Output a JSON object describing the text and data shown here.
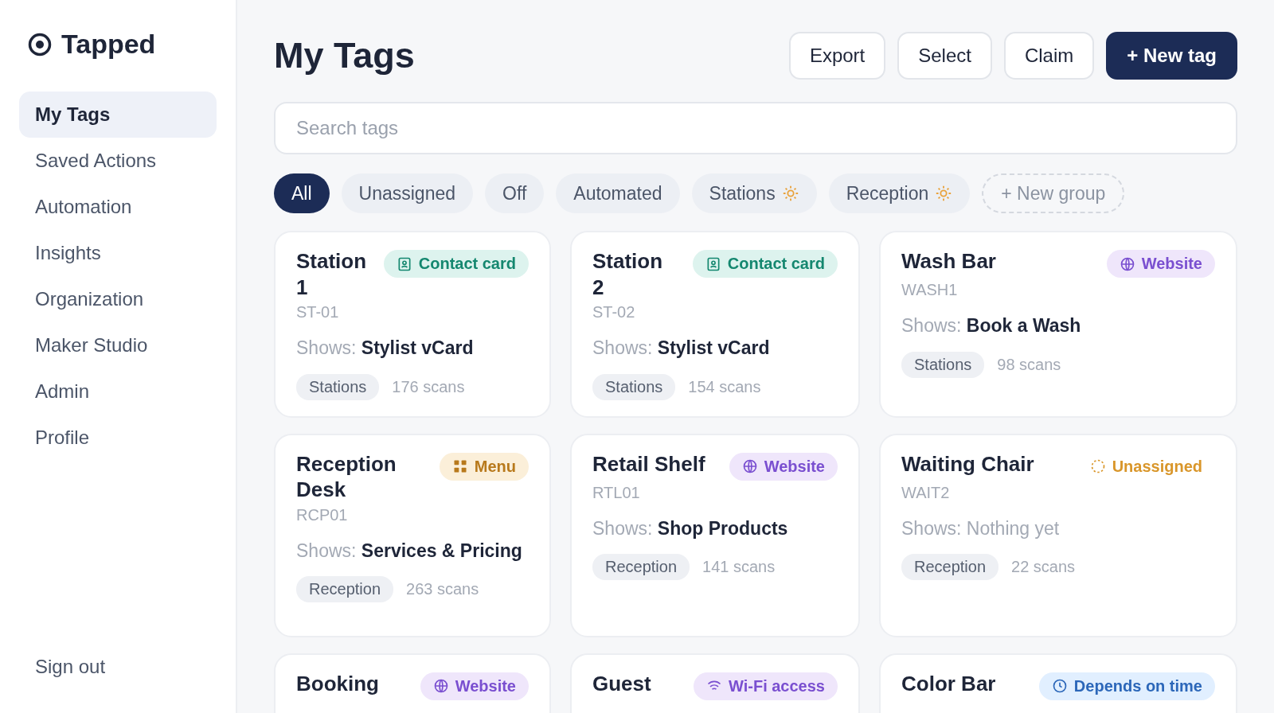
{
  "brand": {
    "name": "Tapped"
  },
  "sidebar": {
    "items": [
      {
        "label": "My Tags",
        "selected": true
      },
      {
        "label": "Saved Actions",
        "selected": false
      },
      {
        "label": "Automation",
        "selected": false
      },
      {
        "label": "Insights",
        "selected": false
      },
      {
        "label": "Organization",
        "selected": false
      },
      {
        "label": "Maker Studio",
        "selected": false
      },
      {
        "label": "Admin",
        "selected": false
      },
      {
        "label": "Profile",
        "selected": false
      }
    ],
    "footer": "Sign out"
  },
  "header": {
    "title": "My Tags",
    "buttons": [
      {
        "label": "Export",
        "kind": "outline"
      },
      {
        "label": "Select",
        "kind": "outline"
      },
      {
        "label": "Claim",
        "kind": "outline"
      },
      {
        "label": "+ New tag",
        "kind": "primary"
      }
    ]
  },
  "search": {
    "placeholder": "Search tags"
  },
  "filters": [
    {
      "label": "All",
      "selected": true,
      "automated": false
    },
    {
      "label": "Unassigned",
      "selected": false,
      "automated": false
    },
    {
      "label": "Off",
      "selected": false,
      "automated": false
    },
    {
      "label": "Automated",
      "selected": false,
      "automated": false
    },
    {
      "label": "Stations",
      "selected": false,
      "automated": true
    },
    {
      "label": "Reception",
      "selected": false,
      "automated": true
    }
  ],
  "new_group": "+ New group",
  "tags": [
    {
      "title": "Station 1",
      "badge": {
        "kind": "contact",
        "label": "Contact card"
      },
      "code": "ST-01",
      "shows": "Shows: **Stylist vCard**",
      "group": "Stations",
      "scans": "176 scans"
    },
    {
      "title": "Station 2",
      "badge": {
        "kind": "contact",
        "label": "Contact card"
      },
      "code": "ST-02",
      "shows": "Shows: **Stylist vCard**",
      "group": "Stations",
      "scans": "154 scans"
    },
    {
      "title": "Wash Bar",
      "badge": {
        "kind": "website",
        "label": "Website"
      },
      "code": "WASH1",
      "shows": "Shows: **Book a Wash**",
      "group": "Stations",
      "scans": "98 scans"
    },
    {
      "title": "Reception Desk",
      "badge": {
        "kind": "menu",
        "label": "Menu"
      },
      "code": "RCP01",
      "shows": "Shows: **Services & Pricing**",
      "group": "Reception",
      "scans": "263 scans"
    },
    {
      "title": "Retail Shelf",
      "badge": {
        "kind": "website",
        "label": "Website"
      },
      "code": "RTL01",
      "shows": "Shows: **Shop Products**",
      "group": "Reception",
      "scans": "141 scans"
    },
    {
      "title": "Waiting Chair",
      "badge": {
        "kind": "unassigned",
        "label": "Unassigned"
      },
      "code": "WAIT2",
      "shows": "Shows: Nothing yet",
      "group": "Reception",
      "scans": "22 scans"
    },
    {
      "title": "Booking",
      "badge": {
        "kind": "website",
        "label": "Website"
      }
    },
    {
      "title": "Guest",
      "badge": {
        "kind": "wifi",
        "label": "Wi-Fi access"
      }
    },
    {
      "title": "Color Bar",
      "badge": {
        "kind": "time",
        "label": "Depends on time"
      }
    }
  ]
}
